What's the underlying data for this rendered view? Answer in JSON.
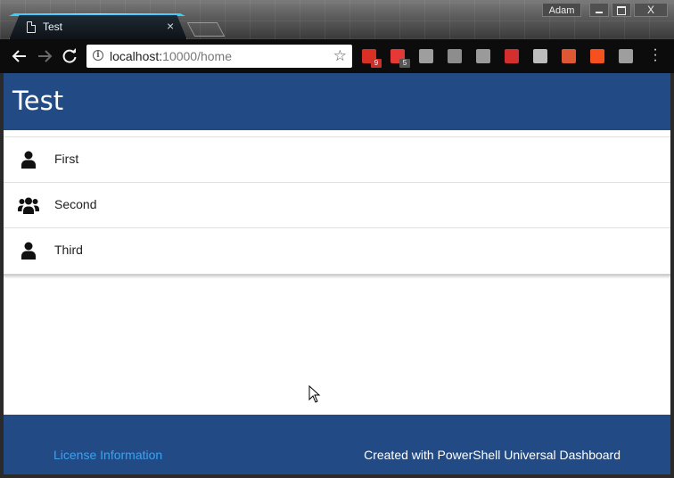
{
  "browser": {
    "tab_title": "Test",
    "tab_close": "×",
    "user_name": "Adam",
    "close_glyph": "X",
    "url_host": "localhost:",
    "url_path": "10000/home",
    "extensions": [
      {
        "name": "gmail-extension-icon",
        "color": "#d93025",
        "badge": "9",
        "badge_color": "#c9302c"
      },
      {
        "name": "more-extension-icon",
        "color": "#e53935",
        "badge": "5",
        "badge_color": "#555555"
      },
      {
        "name": "bss-extension-icon",
        "color": "#9e9e9e",
        "badge": "",
        "badge_color": ""
      },
      {
        "name": "notes-extension-icon",
        "color": "#8d8d8d",
        "badge": "",
        "badge_color": ""
      },
      {
        "name": "google-extension-icon",
        "color": "#9a9a9a",
        "badge": "",
        "badge_color": ""
      },
      {
        "name": "bug-extension-icon",
        "color": "#d32f2f",
        "badge": "",
        "badge_color": ""
      },
      {
        "name": "bucket-extension-icon",
        "color": "#bdbdbd",
        "badge": "",
        "badge_color": ""
      },
      {
        "name": "duckduckgo-extension-icon",
        "color": "#de5833",
        "badge": "",
        "badge_color": ""
      },
      {
        "name": "xa-extension-icon",
        "color": "#f4511e",
        "badge": "",
        "badge_color": ""
      },
      {
        "name": "bulb-extension-icon",
        "color": "#9e9e9e",
        "badge": "",
        "badge_color": ""
      }
    ]
  },
  "app": {
    "title": "Test",
    "header_color": "#224b85",
    "items": [
      {
        "label": "First",
        "icon": "user-icon"
      },
      {
        "label": "Second",
        "icon": "users-icon"
      },
      {
        "label": "Third",
        "icon": "user-icon"
      }
    ],
    "footer": {
      "link_text": "License Information",
      "created_text": "Created with PowerShell Universal Dashboard",
      "link_color": "#3aa2f2"
    }
  }
}
